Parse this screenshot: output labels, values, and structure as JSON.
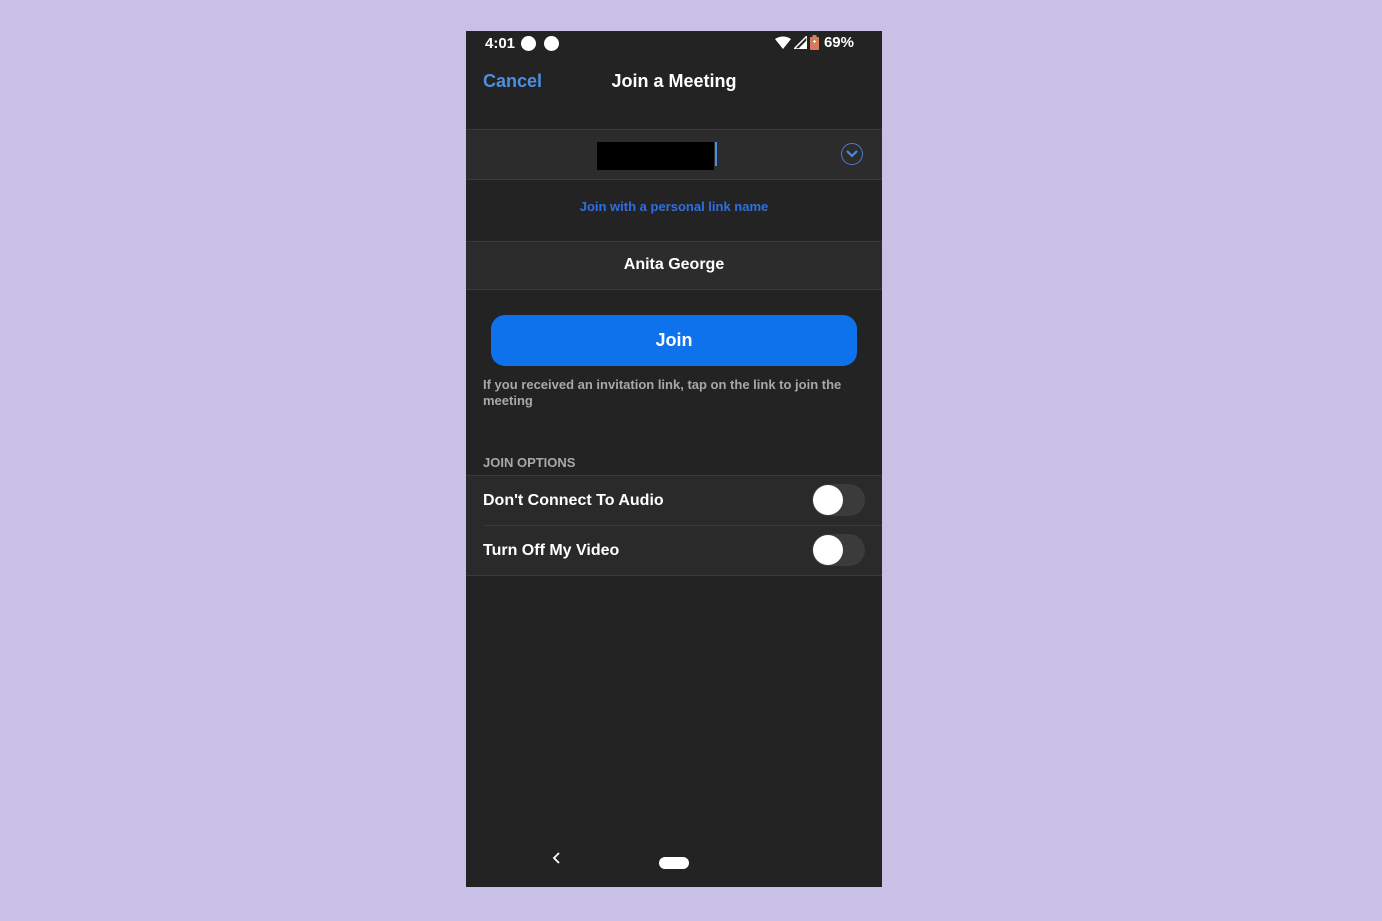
{
  "status_bar": {
    "time": "4:01",
    "battery_percent": "69%",
    "icons": [
      "notification-dot-icon",
      "notification-dot-icon",
      "wifi-icon",
      "cellular-signal-icon",
      "battery-icon"
    ]
  },
  "nav": {
    "cancel_label": "Cancel",
    "title": "Join a Meeting"
  },
  "meeting_id_input": {
    "value": "[redacted]",
    "dropdown_icon": "chevron-down-circle-icon"
  },
  "personal_link_label": "Join with a personal link name",
  "display_name": "Anita George",
  "join_button_label": "Join",
  "hint_text": "If you received an invitation link, tap on the link to join the meeting",
  "join_options": {
    "header": "JOIN OPTIONS",
    "items": [
      {
        "label": "Don't Connect To Audio",
        "enabled": false
      },
      {
        "label": "Turn Off My Video",
        "enabled": false
      }
    ]
  },
  "colors": {
    "accent": "#0e72ed",
    "link": "#2f6fe0",
    "background": "#232323",
    "page_background": "#c8c0e6"
  },
  "system_nav": {
    "icons": [
      "back-icon",
      "home-pill-icon"
    ]
  }
}
